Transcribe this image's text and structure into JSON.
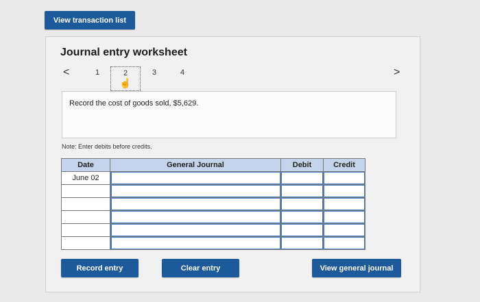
{
  "top": {
    "view_list_label": "View transaction list"
  },
  "worksheet": {
    "title": "Journal entry worksheet",
    "pager": {
      "prev": "<",
      "next": ">",
      "pages": [
        "1",
        "2",
        "3",
        "4"
      ],
      "current": "2"
    },
    "description": "Record the cost of goods sold, $5,629.",
    "note": "Note: Enter debits before credits."
  },
  "table": {
    "headers": [
      "Date",
      "General Journal",
      "Debit",
      "Credit"
    ],
    "rows": [
      {
        "date": "June 02",
        "account": "",
        "debit": "",
        "credit": ""
      },
      {
        "date": "",
        "account": "",
        "debit": "",
        "credit": ""
      },
      {
        "date": "",
        "account": "",
        "debit": "",
        "credit": ""
      },
      {
        "date": "",
        "account": "",
        "debit": "",
        "credit": ""
      },
      {
        "date": "",
        "account": "",
        "debit": "",
        "credit": ""
      },
      {
        "date": "",
        "account": "",
        "debit": "",
        "credit": ""
      }
    ]
  },
  "buttons": {
    "record": "Record entry",
    "clear": "Clear entry",
    "view_general_journal": "View general journal"
  },
  "colors": {
    "button": "#1d5a9c",
    "header": "#c5d4ea",
    "input_border": "#4b7ac1"
  },
  "icons": {
    "pointer": "hand-pointer-icon"
  }
}
